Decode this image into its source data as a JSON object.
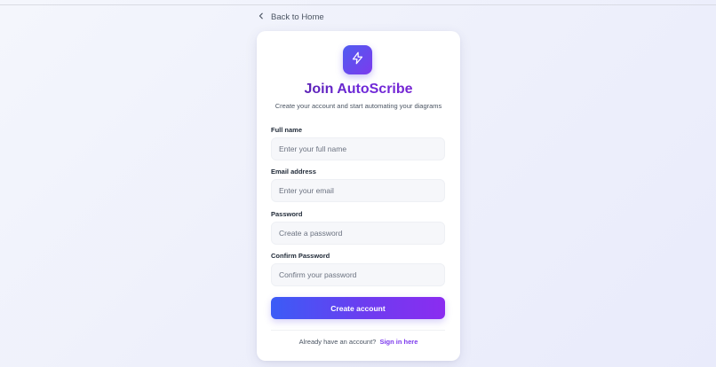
{
  "nav": {
    "back_label": "Back to Home"
  },
  "brand": {
    "icon": "lightning-bolt-icon",
    "accent_start": "#4f5cf0",
    "accent_end": "#7c3aed"
  },
  "form": {
    "title": "Join AutoScribe",
    "subtitle": "Create your account and start automating your diagrams",
    "fields": [
      {
        "label": "Full name",
        "placeholder": "Enter your full name",
        "value": ""
      },
      {
        "label": "Email address",
        "placeholder": "Enter your email",
        "value": ""
      },
      {
        "label": "Password",
        "placeholder": "Create a password",
        "value": ""
      },
      {
        "label": "Confirm Password",
        "placeholder": "Confirm your password",
        "value": ""
      }
    ],
    "submit_label": "Create account",
    "signin_prompt": "Already have an account?",
    "signin_link": "Sign in here"
  }
}
